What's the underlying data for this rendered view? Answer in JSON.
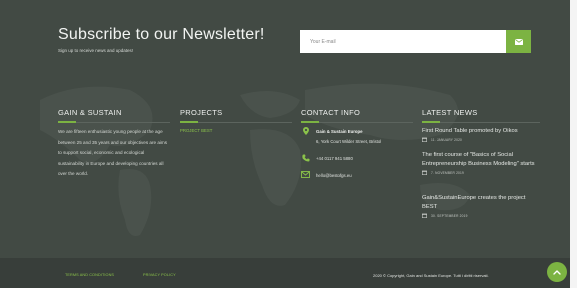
{
  "newsletter": {
    "title": "Subscribe to our Newsletter!",
    "subtitle": "Sign up to receive news and updates!",
    "email_placeholder": "Your E-mail",
    "send_icon": "envelope-icon"
  },
  "columns": {
    "about": {
      "title": "GAIN & SUSTAIN",
      "text": "We are fifteen enthusiastic young people at the age between 25 and 35 years and our objectives are aims to support social, economic and ecological sustainability in Europe and developing countries all over the world."
    },
    "projects": {
      "title": "PROJECTS",
      "links": [
        "PROJECT BEST"
      ]
    },
    "contact": {
      "title": "CONTACT INFO",
      "org_name": "Gain & Sustain Europe",
      "address": "6, York Court Wilder Street, Bristol",
      "phone": "+44 0117 941 5880",
      "email": "hello@bestofgs.eu"
    },
    "news": {
      "title": "LATEST NEWS",
      "items": [
        {
          "title": "First Round Table promoted by Oikos",
          "date": "11. JANUARY 2020"
        },
        {
          "title": "The first course of \"Basics of Social Entrepreneurship Business Modeling\" starts",
          "date": "7. NOVEMBER 2019"
        },
        {
          "title": "Gain&SustainEurope creates the project BEST",
          "date": "30. SEPTEMBER 2019"
        }
      ]
    }
  },
  "bottom": {
    "terms": "TERMS AND CONDITIONS",
    "privacy": "PRIVACY POLICY",
    "copyright": "2020 © Copyright, Gain and Sustain Europe. Tutti i diritti riservati.",
    "scroll_icon": "chevron-up-icon"
  },
  "colors": {
    "background": "#424a44",
    "accent": "#7cb342",
    "bottom_bar": "#383e3a"
  }
}
